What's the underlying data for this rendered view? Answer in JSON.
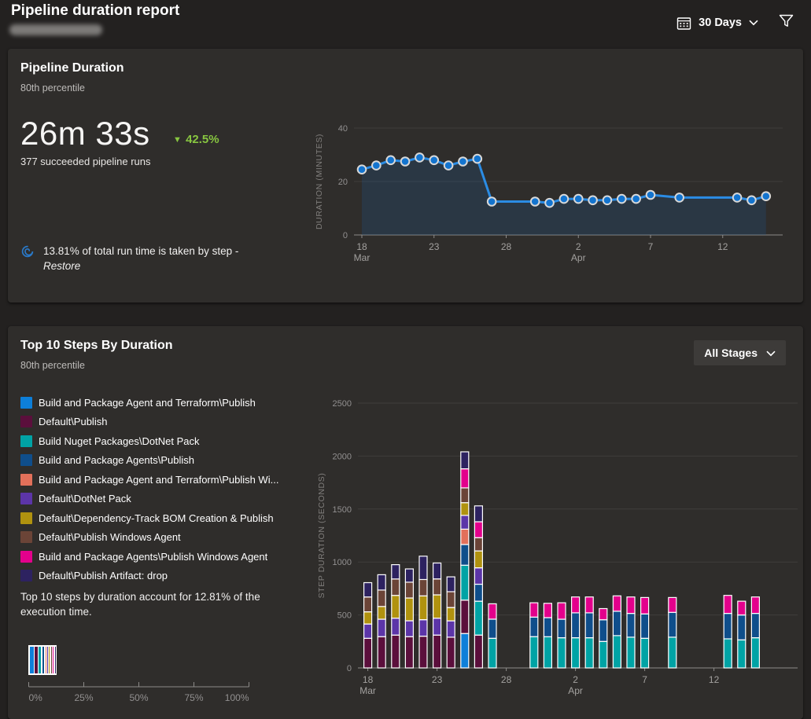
{
  "header": {
    "title": "Pipeline duration report",
    "range_label": "30 Days"
  },
  "card1": {
    "title": "Pipeline Duration",
    "subtitle": "80th percentile",
    "metric": "26m 33s",
    "delta_symbol": "▼",
    "delta_value": "42.5%",
    "delta_color": "#87c540",
    "runs_caption": "377 succeeded pipeline runs",
    "insight_text": "13.81% of total run time is taken by step -",
    "insight_step": "Restore"
  },
  "card2": {
    "title": "Top 10 Steps By Duration",
    "subtitle": "80th percentile",
    "stages_label": "All Stages",
    "summary": "Top 10 steps by duration account for 12.81% of the execution time."
  },
  "chart_data": [
    {
      "type": "area",
      "title": "Pipeline duration trend",
      "ylabel": "DURATION (MINUTES)",
      "ylim": [
        0,
        40
      ],
      "yticks": [
        0,
        20,
        40
      ],
      "line_color": "#2b8ce4",
      "point_fill": "#1374cf",
      "point_ring": "#d8d8d8",
      "area_fill": "rgba(32,84,132,0.28)",
      "xticks": [
        {
          "day": 0,
          "label": "18",
          "month": "Mar"
        },
        {
          "day": 5,
          "label": "23"
        },
        {
          "day": 10,
          "label": "28"
        },
        {
          "day": 15,
          "label": "2",
          "month": "Apr"
        },
        {
          "day": 20,
          "label": "7"
        },
        {
          "day": 25,
          "label": "12"
        }
      ],
      "points": [
        [
          "Mar 18",
          0,
          24.5
        ],
        [
          "Mar 19",
          1,
          26
        ],
        [
          "Mar 20",
          2,
          28
        ],
        [
          "Mar 21",
          3,
          27.5
        ],
        [
          "Mar 22",
          4,
          29
        ],
        [
          "Mar 23",
          5,
          28
        ],
        [
          "Mar 24",
          6,
          26
        ],
        [
          "Mar 25",
          7,
          27.5
        ],
        [
          "Mar 26",
          8,
          28.5
        ],
        [
          "Mar 27",
          9,
          12.5
        ],
        [
          "Mar 30",
          12,
          12.5
        ],
        [
          "Mar 31",
          13,
          12
        ],
        [
          "Apr 1",
          14,
          13.5
        ],
        [
          "Apr 2",
          15,
          13.5
        ],
        [
          "Apr 3",
          16,
          13
        ],
        [
          "Apr 4",
          17,
          13
        ],
        [
          "Apr 5",
          18,
          13.5
        ],
        [
          "Apr 6",
          19,
          13.5
        ],
        [
          "Apr 7",
          20,
          15
        ],
        [
          "Apr 9",
          22,
          14
        ],
        [
          "Apr 13",
          26,
          14
        ],
        [
          "Apr 14",
          27,
          13
        ],
        [
          "Apr 15",
          28,
          14.5
        ]
      ]
    },
    {
      "type": "bar",
      "stacked": true,
      "title": "Top 10 steps by duration",
      "ylabel": "STEP DURATION (SECONDS)",
      "ylim": [
        0,
        2500
      ],
      "yticks": [
        0,
        500,
        1000,
        1500,
        2000,
        2500
      ],
      "bar_outline": "#ffffff",
      "xticks": [
        {
          "day": 0,
          "label": "18",
          "month": "Mar"
        },
        {
          "day": 5,
          "label": "23"
        },
        {
          "day": 10,
          "label": "28"
        },
        {
          "day": 15,
          "label": "2",
          "month": "Apr"
        },
        {
          "day": 20,
          "label": "7"
        },
        {
          "day": 25,
          "label": "12"
        }
      ],
      "series": [
        {
          "name": "Build and Package Agent and Terraform\\Publish",
          "color": "#0d7fd9"
        },
        {
          "name": "Default\\Publish",
          "color": "#5b0f3c"
        },
        {
          "name": "Build Nuget Packages\\DotNet Pack",
          "color": "#00a3a5"
        },
        {
          "name": "Build and Package Agents\\Publish",
          "color": "#0f4e8b"
        },
        {
          "name": "Build and Package Agent and Terraform\\Publish Wi...",
          "color": "#e2705a"
        },
        {
          "name": "Default\\DotNet Pack",
          "color": "#5c35a8"
        },
        {
          "name": "Default\\Dependency-Track BOM Creation & Publish",
          "color": "#b0920f"
        },
        {
          "name": "Default\\Publish Windows Agent",
          "color": "#6b4437"
        },
        {
          "name": "Build and Package Agents\\Publish Windows Agent",
          "color": "#e3008c"
        },
        {
          "name": "Default\\Publish Artifact: drop",
          "color": "#2d2260"
        }
      ],
      "bars": [
        {
          "date": "Mar 18",
          "day": 0,
          "segs": [
            [
              1,
              280
            ],
            [
              5,
              135
            ],
            [
              6,
              115
            ],
            [
              7,
              140
            ],
            [
              9,
              135
            ]
          ]
        },
        {
          "date": "Mar 19",
          "day": 1,
          "segs": [
            [
              1,
              295
            ],
            [
              5,
              165
            ],
            [
              6,
              120
            ],
            [
              7,
              155
            ],
            [
              9,
              145
            ]
          ]
        },
        {
          "date": "Mar 20",
          "day": 2,
          "segs": [
            [
              1,
              310
            ],
            [
              5,
              160
            ],
            [
              6,
              215
            ],
            [
              7,
              155
            ],
            [
              9,
              135
            ]
          ]
        },
        {
          "date": "Mar 21",
          "day": 3,
          "segs": [
            [
              1,
              295
            ],
            [
              5,
              150
            ],
            [
              6,
              215
            ],
            [
              7,
              150
            ],
            [
              9,
              125
            ]
          ]
        },
        {
          "date": "Mar 22",
          "day": 4,
          "segs": [
            [
              1,
              300
            ],
            [
              5,
              155
            ],
            [
              6,
              225
            ],
            [
              7,
              155
            ],
            [
              9,
              220
            ]
          ]
        },
        {
          "date": "Mar 23",
          "day": 5,
          "segs": [
            [
              1,
              310
            ],
            [
              5,
              160
            ],
            [
              6,
              220
            ],
            [
              7,
              150
            ],
            [
              9,
              150
            ]
          ]
        },
        {
          "date": "Mar 24",
          "day": 6,
          "segs": [
            [
              1,
              290
            ],
            [
              5,
              155
            ],
            [
              6,
              125
            ],
            [
              7,
              150
            ],
            [
              9,
              140
            ]
          ]
        },
        {
          "date": "Mar 25",
          "day": 7,
          "segs": [
            [
              0,
              325
            ],
            [
              1,
              315
            ],
            [
              2,
              330
            ],
            [
              3,
              195
            ],
            [
              4,
              145
            ],
            [
              5,
              130
            ],
            [
              6,
              120
            ],
            [
              7,
              140
            ],
            [
              8,
              180
            ],
            [
              9,
              160
            ]
          ]
        },
        {
          "date": "Mar 26",
          "day": 8,
          "segs": [
            [
              1,
              310
            ],
            [
              2,
              320
            ],
            [
              3,
              160
            ],
            [
              5,
              155
            ],
            [
              6,
              160
            ],
            [
              7,
              125
            ],
            [
              8,
              150
            ],
            [
              9,
              150
            ]
          ]
        },
        {
          "date": "Mar 27",
          "day": 9,
          "segs": [
            [
              2,
              280
            ],
            [
              3,
              180
            ],
            [
              8,
              145
            ]
          ]
        },
        {
          "date": "Mar 30",
          "day": 12,
          "segs": [
            [
              2,
              295
            ],
            [
              3,
              185
            ],
            [
              8,
              135
            ]
          ]
        },
        {
          "date": "Mar 31",
          "day": 13,
          "segs": [
            [
              2,
              295
            ],
            [
              3,
              180
            ],
            [
              8,
              135
            ]
          ]
        },
        {
          "date": "Apr 1",
          "day": 14,
          "segs": [
            [
              2,
              285
            ],
            [
              3,
              175
            ],
            [
              8,
              155
            ]
          ]
        },
        {
          "date": "Apr 2",
          "day": 15,
          "segs": [
            [
              2,
              285
            ],
            [
              3,
              235
            ],
            [
              8,
              150
            ]
          ]
        },
        {
          "date": "Apr 3",
          "day": 16,
          "segs": [
            [
              2,
              285
            ],
            [
              3,
              235
            ],
            [
              8,
              150
            ]
          ]
        },
        {
          "date": "Apr 4",
          "day": 17,
          "segs": [
            [
              2,
              250
            ],
            [
              3,
              205
            ],
            [
              8,
              105
            ]
          ]
        },
        {
          "date": "Apr 5",
          "day": 18,
          "segs": [
            [
              2,
              305
            ],
            [
              3,
              230
            ],
            [
              8,
              145
            ]
          ]
        },
        {
          "date": "Apr 6",
          "day": 19,
          "segs": [
            [
              2,
              290
            ],
            [
              3,
              225
            ],
            [
              8,
              155
            ]
          ]
        },
        {
          "date": "Apr 7",
          "day": 20,
          "segs": [
            [
              2,
              280
            ],
            [
              3,
              230
            ],
            [
              8,
              155
            ]
          ]
        },
        {
          "date": "Apr 9",
          "day": 22,
          "segs": [
            [
              2,
              290
            ],
            [
              3,
              235
            ],
            [
              8,
              140
            ]
          ]
        },
        {
          "date": "Apr 13",
          "day": 26,
          "segs": [
            [
              2,
              275
            ],
            [
              3,
              240
            ],
            [
              8,
              170
            ]
          ]
        },
        {
          "date": "Apr 14",
          "day": 27,
          "segs": [
            [
              2,
              265
            ],
            [
              3,
              235
            ],
            [
              8,
              130
            ]
          ]
        },
        {
          "date": "Apr 15",
          "day": 28,
          "segs": [
            [
              2,
              285
            ],
            [
              3,
              230
            ],
            [
              8,
              155
            ]
          ]
        }
      ]
    },
    {
      "type": "bar",
      "title": "Share of execution time",
      "orientation": "horizontal-percent",
      "xlim": [
        0,
        100
      ],
      "xticks": [
        "0%",
        "25%",
        "50%",
        "75%",
        "100%"
      ],
      "segment_percents": [
        3.2,
        2.4,
        2.1,
        1.5,
        0.6,
        0.6,
        0.6,
        0.5,
        0.7,
        0.5
      ],
      "total_percent_shown": 13
    }
  ]
}
